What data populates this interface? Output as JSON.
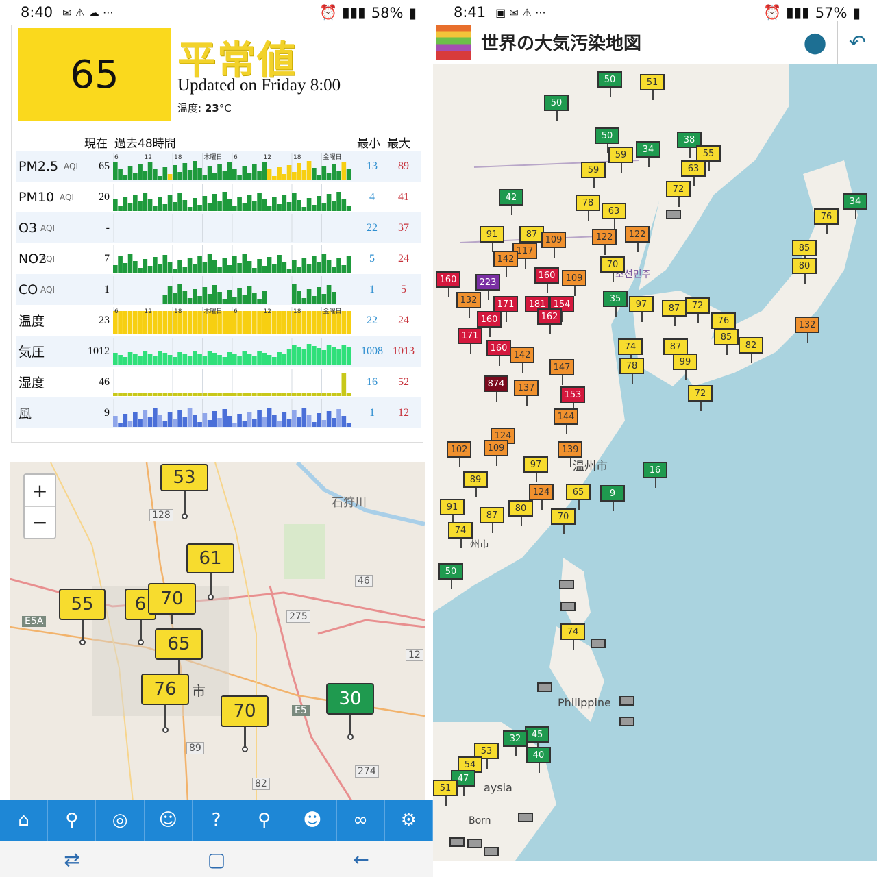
{
  "left_screen": {
    "status": {
      "time": "8:40",
      "battery": "58%"
    },
    "aqi": {
      "value": "65",
      "level": "平常値",
      "updated": "Updated on Friday 8:00",
      "temp_label": "温度:",
      "temp_value": "23",
      "temp_unit": "°C"
    },
    "headers": {
      "current": "現在",
      "past48": "過去48時間",
      "min": "最小",
      "max": "最大"
    },
    "rows": [
      {
        "name": "PM2.5",
        "unit": "AQI",
        "current": "65",
        "min": "13",
        "max": "89",
        "color": "#1e9a3c"
      },
      {
        "name": "PM10",
        "unit": "AQI",
        "current": "20",
        "min": "4",
        "max": "41",
        "color": "#1e9a3c"
      },
      {
        "name": "O3",
        "unit": "AQI",
        "current": "-",
        "min": "22",
        "max": "37",
        "color": "#1e9a3c"
      },
      {
        "name": "NO2",
        "unit": "AQI",
        "current": "7",
        "min": "5",
        "max": "24",
        "color": "#1e9a3c"
      },
      {
        "name": "CO",
        "unit": "AQI",
        "current": "1",
        "min": "1",
        "max": "5",
        "color": "#1e9a3c"
      },
      {
        "name": "温度",
        "unit": "",
        "current": "23",
        "min": "22",
        "max": "24",
        "color": "#f7cf11"
      },
      {
        "name": "気圧",
        "unit": "",
        "current": "1012",
        "min": "1008",
        "max": "1013",
        "color": "#2fe07a"
      },
      {
        "name": "湿度",
        "unit": "",
        "current": "46",
        "min": "16",
        "max": "52",
        "color": "#c8c81a"
      },
      {
        "name": "風",
        "unit": "",
        "current": "9",
        "min": "1",
        "max": "12",
        "color": "#4a6fd8"
      }
    ],
    "time_ticks": [
      "6",
      "12",
      "18",
      "木曜日",
      "6",
      "12",
      "18",
      "金曜日",
      "6"
    ],
    "map": {
      "zoom_in": "+",
      "zoom_out": "−",
      "labels": [
        "石狩川",
        "128",
        "46",
        "275",
        "12",
        "89",
        "82",
        "274",
        "E5",
        "E5A",
        "市"
      ],
      "pins": [
        {
          "v": "53",
          "color": "#f7dc2e"
        },
        {
          "v": "61",
          "color": "#f7dc2e"
        },
        {
          "v": "55",
          "color": "#f7dc2e"
        },
        {
          "v": "6",
          "color": "#f7dc2e"
        },
        {
          "v": "70",
          "color": "#f7dc2e"
        },
        {
          "v": "65",
          "color": "#f7dc2e"
        },
        {
          "v": "76",
          "color": "#f7dc2e"
        },
        {
          "v": "70",
          "color": "#f7dc2e"
        },
        {
          "v": "30",
          "color": "#1f9a4f"
        }
      ]
    },
    "bottom_nav": [
      "home-icon",
      "map-pin-icon",
      "globe-icon",
      "mask-icon",
      "faq-icon",
      "search-icon",
      "person-chat-icon",
      "link-icon",
      "gear-icon"
    ]
  },
  "right_screen": {
    "status": {
      "time": "8:41",
      "battery": "57%"
    },
    "title": "世界の大気汚染地図",
    "map_labels": [
      "温州市",
      "Philippine",
      "aysia",
      "Born",
      "조선민주",
      "州市"
    ],
    "flags": [
      {
        "v": "50",
        "c": "#1f9a4f"
      },
      {
        "v": "51",
        "c": "#f7dc2e"
      },
      {
        "v": "50",
        "c": "#1f9a4f"
      },
      {
        "v": "50",
        "c": "#1f9a4f"
      },
      {
        "v": "38",
        "c": "#1f9a4f"
      },
      {
        "v": "59",
        "c": "#f7dc2e"
      },
      {
        "v": "34",
        "c": "#1f9a4f"
      },
      {
        "v": "55",
        "c": "#f7dc2e"
      },
      {
        "v": "63",
        "c": "#f7dc2e"
      },
      {
        "v": "72",
        "c": "#f7dc2e"
      },
      {
        "v": "42",
        "c": "#1f9a4f"
      },
      {
        "v": "78",
        "c": "#f7dc2e"
      },
      {
        "v": "63",
        "c": "#f7dc2e"
      },
      {
        "v": "59",
        "c": "#f7dc2e"
      },
      {
        "v": "76",
        "c": "#f7dc2e"
      },
      {
        "v": "34",
        "c": "#1f9a4f"
      },
      {
        "v": "91",
        "c": "#f7dc2e"
      },
      {
        "v": "87",
        "c": "#f7dc2e"
      },
      {
        "v": "109",
        "c": "#f0912e"
      },
      {
        "v": "122",
        "c": "#f0912e"
      },
      {
        "v": "122",
        "c": "#f0912e"
      },
      {
        "v": "117",
        "c": "#f0912e"
      },
      {
        "v": "70",
        "c": "#f7dc2e"
      },
      {
        "v": "85",
        "c": "#f7dc2e"
      },
      {
        "v": "80",
        "c": "#f7dc2e"
      },
      {
        "v": "142",
        "c": "#f0912e"
      },
      {
        "v": "160",
        "c": "#d4183d"
      },
      {
        "v": "223",
        "c": "#7a2fa3"
      },
      {
        "v": "160",
        "c": "#d4183d"
      },
      {
        "v": "109",
        "c": "#f0912e"
      },
      {
        "v": "132",
        "c": "#f0912e"
      },
      {
        "v": "171",
        "c": "#d4183d"
      },
      {
        "v": "181",
        "c": "#d4183d"
      },
      {
        "v": "154",
        "c": "#d4183d"
      },
      {
        "v": "35",
        "c": "#1f9a4f"
      },
      {
        "v": "97",
        "c": "#f7dc2e"
      },
      {
        "v": "87",
        "c": "#f7dc2e"
      },
      {
        "v": "72",
        "c": "#f7dc2e"
      },
      {
        "v": "160",
        "c": "#d4183d"
      },
      {
        "v": "162",
        "c": "#d4183d"
      },
      {
        "v": "76",
        "c": "#f7dc2e"
      },
      {
        "v": "132",
        "c": "#f0912e"
      },
      {
        "v": "171",
        "c": "#d4183d"
      },
      {
        "v": "74",
        "c": "#f7dc2e"
      },
      {
        "v": "87",
        "c": "#f7dc2e"
      },
      {
        "v": "85",
        "c": "#f7dc2e"
      },
      {
        "v": "82",
        "c": "#f7dc2e"
      },
      {
        "v": "160",
        "c": "#d4183d"
      },
      {
        "v": "142",
        "c": "#f0912e"
      },
      {
        "v": "147",
        "c": "#f0912e"
      },
      {
        "v": "78",
        "c": "#f7dc2e"
      },
      {
        "v": "99",
        "c": "#f7dc2e"
      },
      {
        "v": "874",
        "c": "#7a0a1e"
      },
      {
        "v": "137",
        "c": "#f0912e"
      },
      {
        "v": "153",
        "c": "#d4183d"
      },
      {
        "v": "72",
        "c": "#f7dc2e"
      },
      {
        "v": "144",
        "c": "#f0912e"
      },
      {
        "v": "124",
        "c": "#f0912e"
      },
      {
        "v": "139",
        "c": "#f0912e"
      },
      {
        "v": "102",
        "c": "#f0912e"
      },
      {
        "v": "109",
        "c": "#f0912e"
      },
      {
        "v": "97",
        "c": "#f7dc2e"
      },
      {
        "v": "16",
        "c": "#1f9a4f"
      },
      {
        "v": "89",
        "c": "#f7dc2e"
      },
      {
        "v": "124",
        "c": "#f0912e"
      },
      {
        "v": "65",
        "c": "#f7dc2e"
      },
      {
        "v": "9",
        "c": "#1f9a4f"
      },
      {
        "v": "91",
        "c": "#f7dc2e"
      },
      {
        "v": "87",
        "c": "#f7dc2e"
      },
      {
        "v": "80",
        "c": "#f7dc2e"
      },
      {
        "v": "70",
        "c": "#f7dc2e"
      },
      {
        "v": "74",
        "c": "#f7dc2e"
      },
      {
        "v": "50",
        "c": "#1f9a4f"
      },
      {
        "v": "74",
        "c": "#f7dc2e"
      },
      {
        "v": "45",
        "c": "#1f9a4f"
      },
      {
        "v": "32",
        "c": "#1f9a4f"
      },
      {
        "v": "40",
        "c": "#1f9a4f"
      },
      {
        "v": "53",
        "c": "#f7dc2e"
      },
      {
        "v": "54",
        "c": "#f7dc2e"
      },
      {
        "v": "47",
        "c": "#1f9a4f"
      },
      {
        "v": "51",
        "c": "#f7dc2e"
      }
    ]
  }
}
